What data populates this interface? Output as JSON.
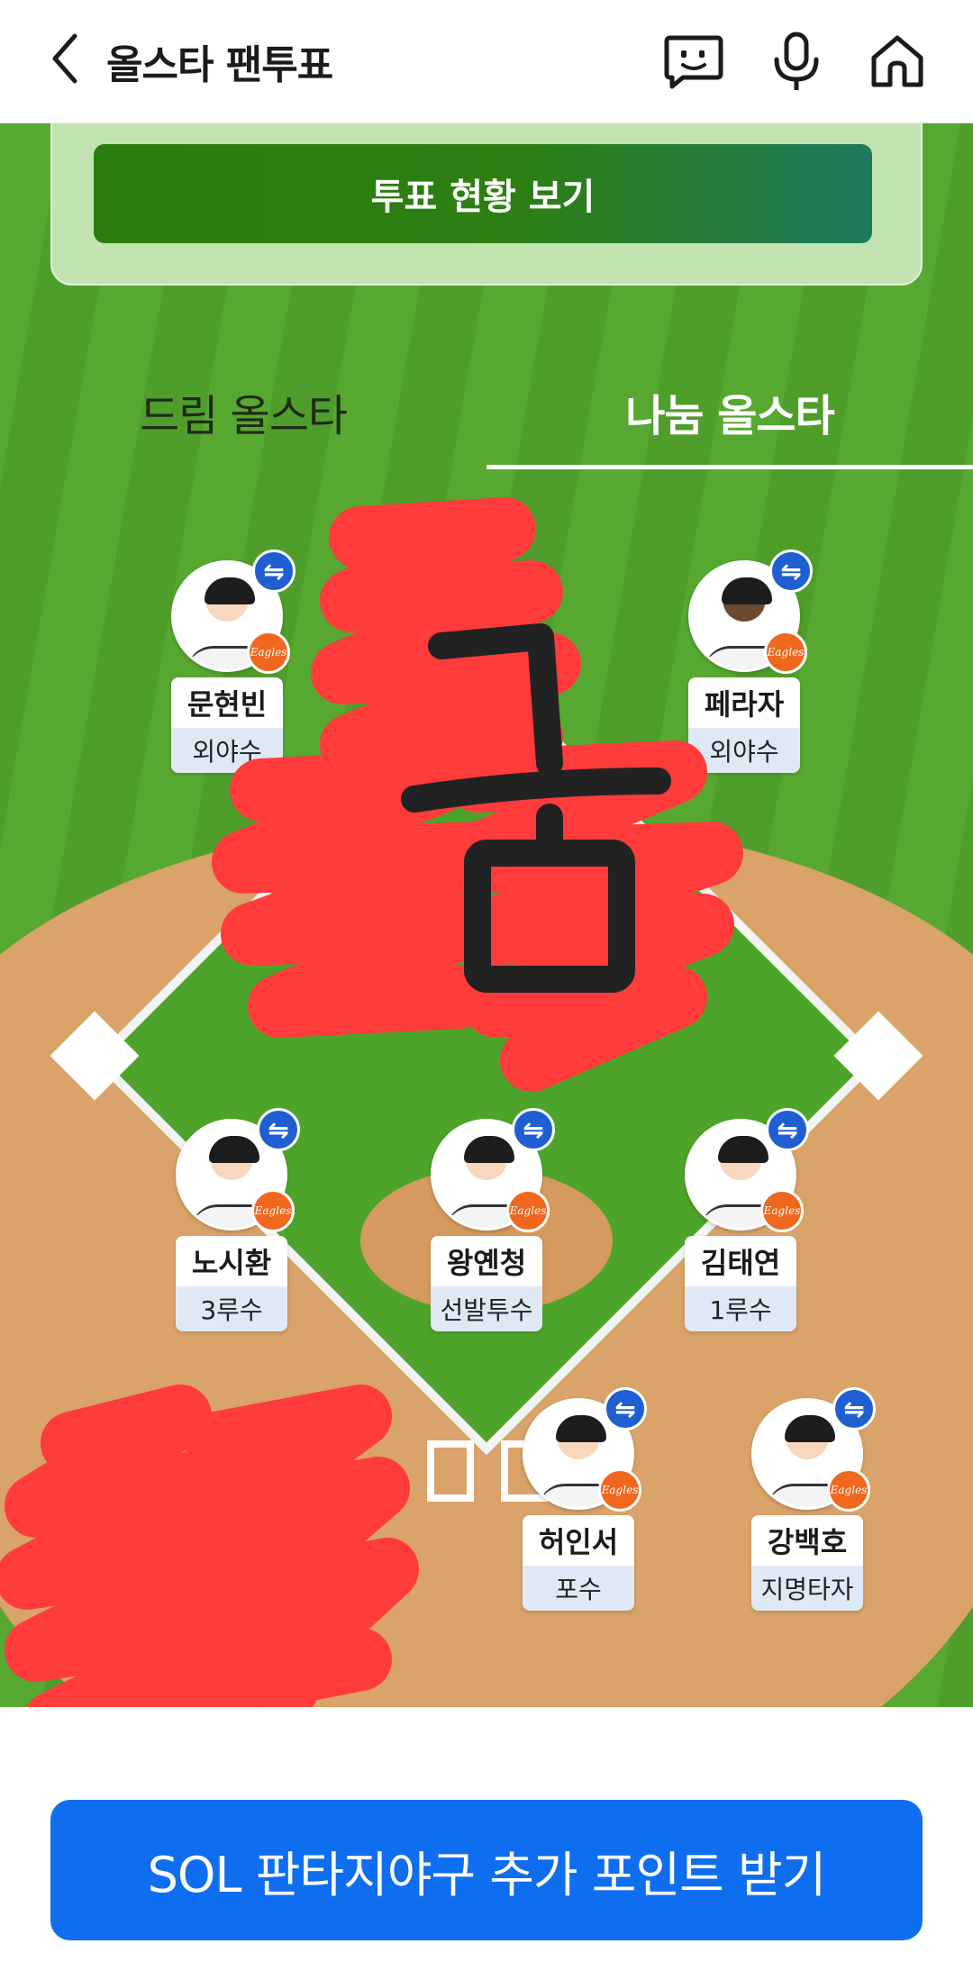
{
  "header": {
    "title": "올스타 팬투표",
    "icons": [
      "back-icon",
      "chat-bot-icon",
      "microphone-icon",
      "home-icon"
    ]
  },
  "vote_status_button": "투표 현황 보기",
  "tabs": [
    {
      "label": "드림 올스타",
      "selected": false
    },
    {
      "label": "나눔 올스타",
      "selected": true
    }
  ],
  "players": [
    {
      "name": "문현빈",
      "position": "외야수"
    },
    {
      "name": "페라자",
      "position": "외야수"
    },
    {
      "name": "노시환",
      "position": "3루수"
    },
    {
      "name": "왕옌청",
      "position": "선발투수"
    },
    {
      "name": "김태연",
      "position": "1루수"
    },
    {
      "name": "허인서",
      "position": "포수"
    },
    {
      "name": "강백호",
      "position": "지명타자"
    }
  ],
  "team_logo_text": "Eagles",
  "swap_icon_glyph": "⇋",
  "bottom_button": "SOL 판타지야구 추가 포인트 받기",
  "colors": {
    "field_green": "#55a62f",
    "dirt": "#d9a369",
    "primary_blue": "#0f6ef0",
    "swap_blue": "#1f5fd1",
    "team_orange": "#f0671e",
    "scribble_red": "#ff3b3b"
  }
}
